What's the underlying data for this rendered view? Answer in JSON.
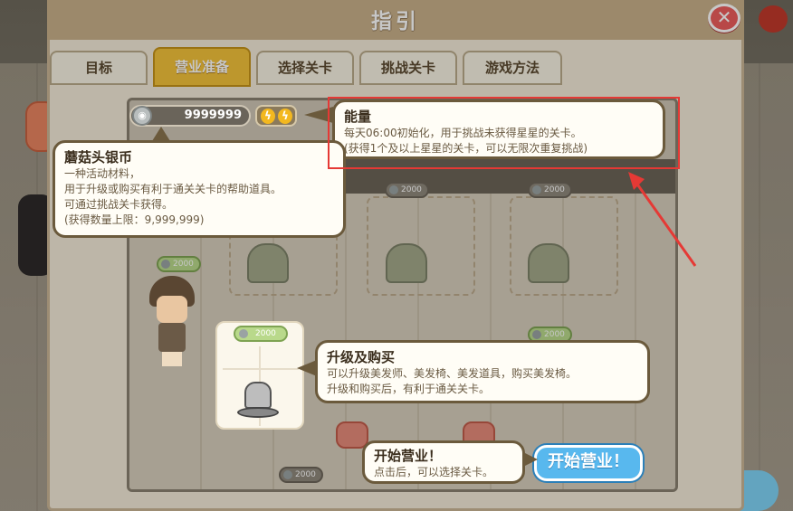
{
  "window": {
    "title": "指引",
    "close_label": "✕"
  },
  "tabs": [
    {
      "label": "目标",
      "active": false
    },
    {
      "label": "营业准备",
      "active": true
    },
    {
      "label": "选择关卡",
      "active": false
    },
    {
      "label": "挑战关卡",
      "active": false
    },
    {
      "label": "游戏方法",
      "active": false
    }
  ],
  "resources": {
    "silver_amount": "9999999",
    "energy_count": 2
  },
  "tips": {
    "energy": {
      "title": "能量",
      "line1": "每天06:00初始化，用于挑战未获得星星的关卡。",
      "line2": "(获得1个及以上星星的关卡，可以无限次重复挑战)"
    },
    "silver": {
      "title": "蘑菇头银币",
      "line1": "一种活动材料，",
      "line2": "用于升级或购买有利于通关关卡的帮助道具。",
      "line3": "可通过挑战关卡获得。",
      "line4": "(获得数量上限：9,999,999)"
    },
    "upgrade": {
      "title": "升级及购买",
      "line1": "可以升级美发师、美发椅、美发道具，购买美发椅。",
      "line2": "升级和购买后，有利于通关关卡。"
    },
    "start": {
      "title": "开始营业！",
      "line1": "点击后，可以选择关卡。"
    }
  },
  "board": {
    "prices": [
      "2000",
      "2000",
      "2000",
      "2000",
      "2000",
      "2000",
      "2000"
    ],
    "highlight_price": "2000"
  },
  "start_button": {
    "label": "开始营业！"
  },
  "colors": {
    "tab_active": "#f2c23a",
    "start_button": "#58b8ee",
    "annotation": "#e53935",
    "close_button": "#ec5d5d"
  }
}
